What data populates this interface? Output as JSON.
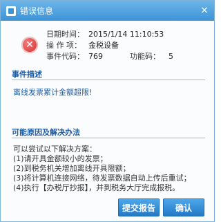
{
  "window": {
    "title": "错误信息",
    "close_glyph": "×"
  },
  "summary": {
    "icon": "error-icon",
    "date_label": "日期时间：",
    "date_value": "2015/1/14 11:10:53",
    "op_label": "操 作 项：",
    "op_value": "金税设备",
    "code_label": "事件代码：",
    "code_value": "769",
    "func_label": "功能码：",
    "func_value": "5"
  },
  "event": {
    "heading": "事件描述",
    "text": "离线发票累计金额超限!"
  },
  "solution": {
    "heading": "可能原因及解决办法",
    "lines": [
      "可以尝试以下解决方案：",
      "(1)请开具金额较小的发票；",
      "(2)到税务机关增加离线开具限额；",
      "(3)将计算机连接网络，待发票数据自动上传后重试；",
      "(4)执行【办税厅抄报】，并到税务大厅完成报税。"
    ]
  },
  "buttons": {
    "submit": "提交报告",
    "confirm": "确认"
  },
  "colors": {
    "titlebar": "#3d93d6",
    "heading": "#1b5aa3",
    "button": "#2479c6",
    "error": "#d12b2b"
  }
}
